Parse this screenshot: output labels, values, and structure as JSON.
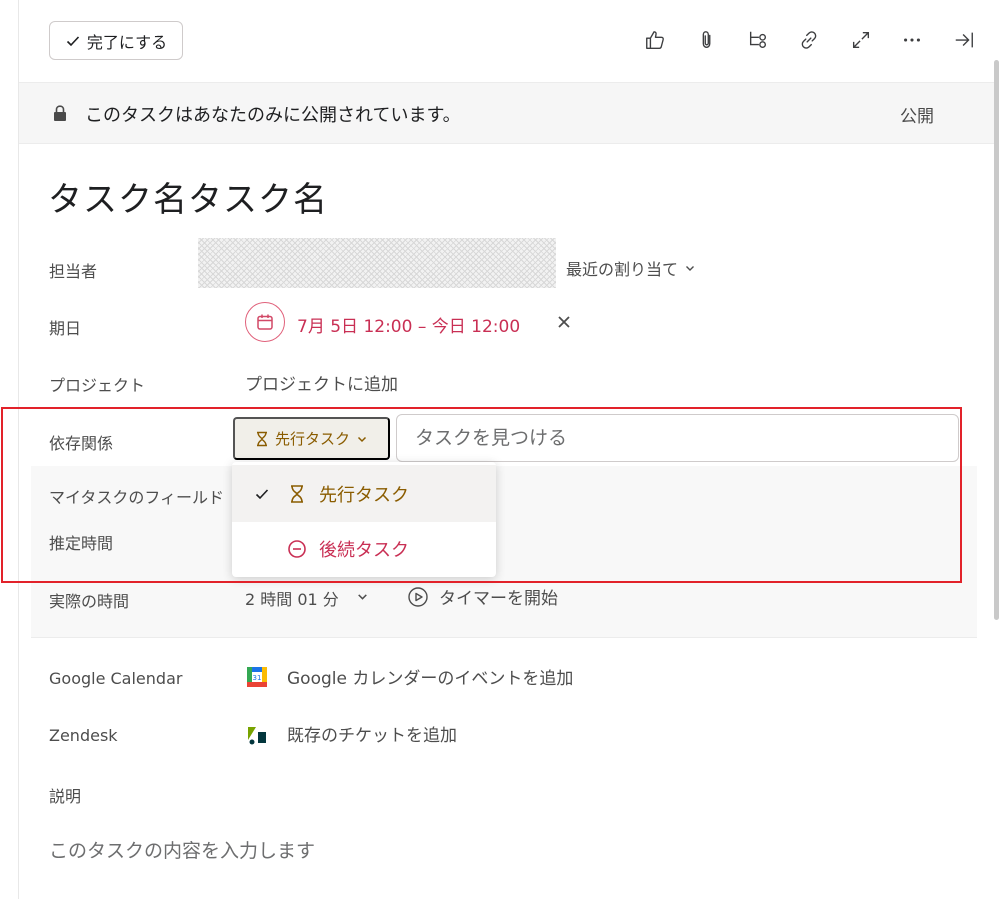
{
  "toolbar": {
    "complete_label": "完了にする"
  },
  "privacy": {
    "message": "このタスクはあなたのみに公開されています。",
    "public_label": "公開"
  },
  "task": {
    "title": "タスク名タスク名"
  },
  "fields": {
    "assignee": {
      "label": "担当者",
      "recent_label": "最近の割り当て"
    },
    "due": {
      "label": "期日",
      "value": "7月 5日 12:00 – 今日 12:00"
    },
    "project": {
      "label": "プロジェクト",
      "value": "プロジェクトに追加"
    },
    "dependency": {
      "label": "依存関係",
      "type_label": "先行タスク",
      "search_placeholder": "タスクを見つける",
      "options": [
        {
          "label": "先行タスク",
          "selected": true
        },
        {
          "label": "後続タスク",
          "selected": false
        }
      ]
    },
    "my_task_fields": {
      "label": "マイタスクのフィールド"
    },
    "estimated_time": {
      "label": "推定時間"
    },
    "actual_time": {
      "label": "実際の時間",
      "value": "2 時間 01 分",
      "timer_label": "タイマーを開始"
    },
    "google_calendar": {
      "label": "Google Calendar",
      "value": "Google カレンダーのイベントを追加"
    },
    "zendesk": {
      "label": "Zendesk",
      "value": "既存のチケットを追加"
    },
    "description": {
      "label": "説明",
      "placeholder": "このタスクの内容を入力します"
    }
  },
  "colors": {
    "due_red": "#c92f54",
    "predecessor_gold": "#8a5c00",
    "successor_pink": "#c92f54",
    "highlight_red": "#e2222a"
  }
}
